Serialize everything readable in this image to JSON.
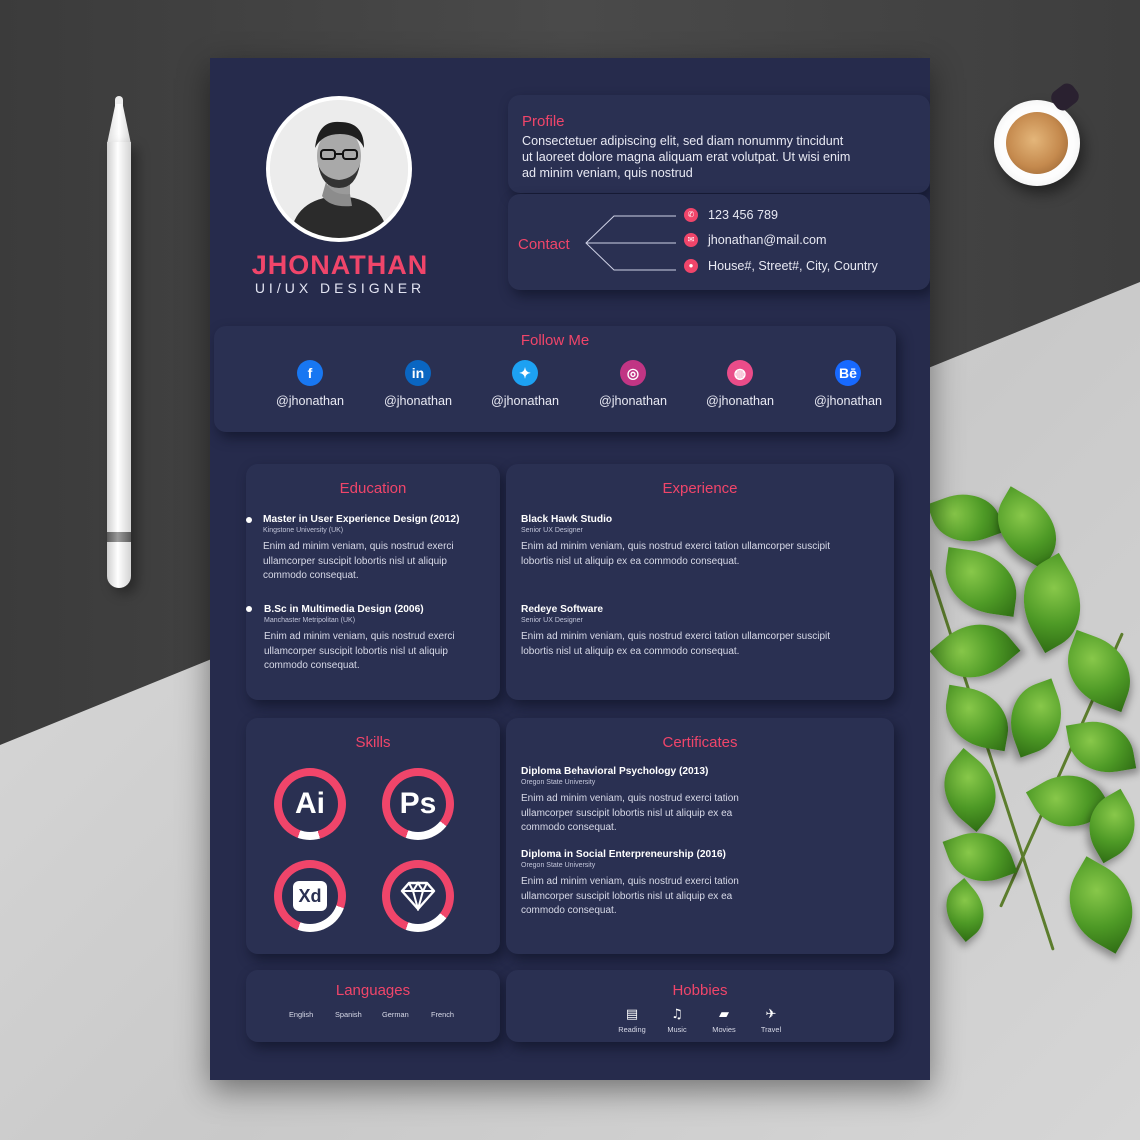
{
  "person": {
    "first_name": "JHONATHAN",
    "title": "UI/UX DESIGNER"
  },
  "profile": {
    "heading": "Profile",
    "lines": [
      "Consectetuer adipiscing elit, sed diam nonummy tincidunt",
      "ut laoreet dolore magna aliquam erat volutpat. Ut wisi enim",
      "ad minim veniam, quis nostrud"
    ]
  },
  "contact": {
    "heading": "Contact",
    "phone": "123 456 789",
    "email": "jhonathan@mail.com",
    "address": "House#, Street#, City, Country"
  },
  "follow": {
    "heading": "Follow Me",
    "items": [
      {
        "network": "facebook-icon",
        "glyph": "f",
        "color": "#1877f2",
        "handle": "@jhonathan"
      },
      {
        "network": "linkedin-icon",
        "glyph": "in",
        "color": "#0a66c2",
        "handle": "@jhonathan"
      },
      {
        "network": "twitter-icon",
        "glyph": "✦",
        "color": "#1da1f2",
        "handle": "@jhonathan"
      },
      {
        "network": "instagram-icon",
        "glyph": "◎",
        "color": "#c13584",
        "handle": "@jhonathan"
      },
      {
        "network": "dribbble-icon",
        "glyph": "◍",
        "color": "#ea4c89",
        "handle": "@jhonathan"
      },
      {
        "network": "behance-icon",
        "glyph": "Bē",
        "color": "#1769ff",
        "handle": "@jhonathan"
      }
    ]
  },
  "education": {
    "heading": "Education",
    "items": [
      {
        "title": "Master in User Experience Design (2012)",
        "institution": "Kingstone University (UK)",
        "lines": [
          "Enim ad minim veniam, quis nostrud exerci",
          "ullamcorper suscipit lobortis nisl ut aliquip",
          "commodo consequat."
        ]
      },
      {
        "title": "B.Sc in Multimedia Design (2006)",
        "institution": "Manchaster Metripolitan (UK)",
        "lines": [
          "Enim ad minim veniam, quis nostrud exerci",
          "ullamcorper suscipit lobortis nisl ut aliquip",
          "commodo consequat."
        ]
      }
    ]
  },
  "experience": {
    "heading": "Experience",
    "items": [
      {
        "company": "Black Hawk Studio",
        "role": "Senior UX Designer",
        "lines": [
          "Enim ad minim veniam, quis nostrud exerci tation ullamcorper suscipit",
          "lobortis nisl ut aliquip ex ea commodo consequat."
        ]
      },
      {
        "company": "Redeye Software",
        "role": "Senior UX Designer",
        "lines": [
          "Enim ad minim veniam, quis nostrud exerci tation ullamcorper suscipit",
          "lobortis nisl ut aliquip ex ea commodo consequat."
        ]
      }
    ]
  },
  "skills": {
    "heading": "Skills",
    "items": [
      {
        "label": "Ai",
        "icon": "illustrator-icon",
        "level": 0.9
      },
      {
        "label": "Ps",
        "icon": "photoshop-icon",
        "level": 0.8
      },
      {
        "label": "Xd",
        "icon": "xd-icon",
        "level": 0.75
      },
      {
        "label": "",
        "icon": "sketch-diamond-icon",
        "level": 0.8
      }
    ],
    "accent": "#f0456a"
  },
  "certificates": {
    "heading": "Certificates",
    "items": [
      {
        "title": "Diploma Behavioral Psychology (2013)",
        "institution": "Oregon State University",
        "lines": [
          "Enim ad minim veniam, quis nostrud exerci tation",
          "ullamcorper suscipit lobortis nisl ut aliquip ex ea",
          "commodo consequat."
        ]
      },
      {
        "title": "Diploma in Social Enterpreneurship (2016)",
        "institution": "Oregon State University",
        "lines": [
          "Enim ad minim veniam, quis nostrud exerci tation",
          "ullamcorper suscipit lobortis nisl ut aliquip ex ea",
          "commodo consequat."
        ]
      }
    ]
  },
  "languages": {
    "heading": "Languages",
    "items": [
      "English",
      "Spanish",
      "German",
      "French"
    ]
  },
  "hobbies": {
    "heading": "Hobbies",
    "items": [
      {
        "label": "Reading",
        "icon": "book-icon",
        "glyph": "▤"
      },
      {
        "label": "Music",
        "icon": "music-note-icon",
        "glyph": "♫"
      },
      {
        "label": "Movies",
        "icon": "clapperboard-icon",
        "glyph": "▰"
      },
      {
        "label": "Travel",
        "icon": "airplane-icon",
        "glyph": "✈"
      }
    ]
  },
  "colors": {
    "accent": "#f0456a",
    "paper": "#262b4c",
    "panel": "#2a3052"
  }
}
